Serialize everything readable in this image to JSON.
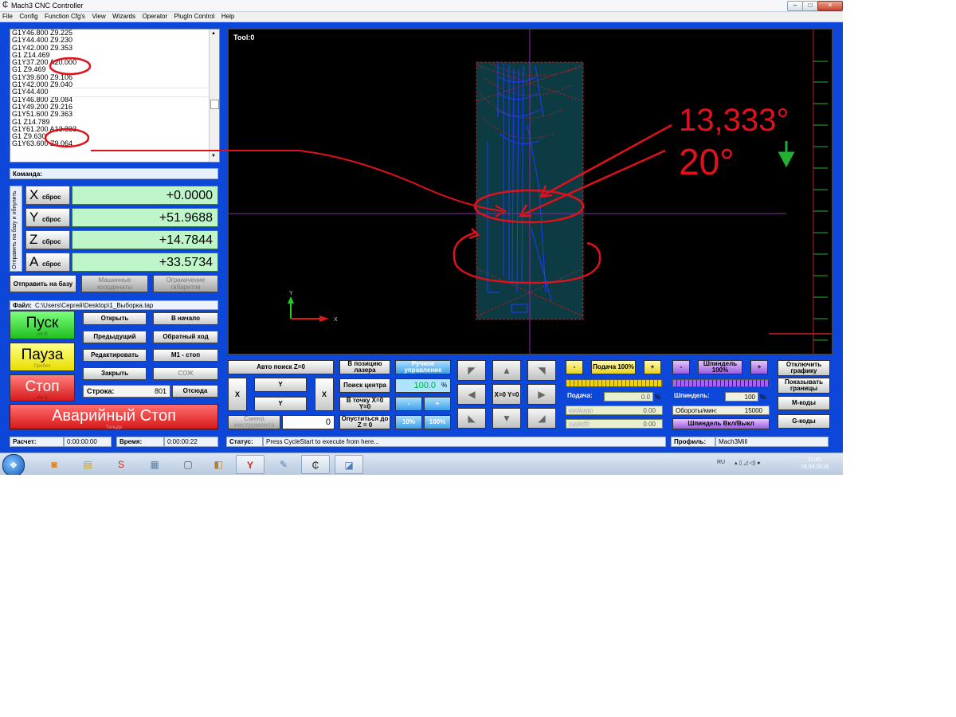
{
  "window": {
    "title": "Mach3 CNC Controller",
    "min": "–",
    "max": "□",
    "close": "✕"
  },
  "menu": [
    "File",
    "Config",
    "Function Cfg's",
    "View",
    "Wizards",
    "Operator",
    "PlugIn Control",
    "Help"
  ],
  "gcode_lines": [
    "G1Y46.800 Z9.225",
    "G1Y44.400 Z9.230",
    "G1Y42.000 Z9.353",
    "G1 Z14.469",
    "G1Y37.200 A20.000",
    "G1 Z9.469",
    "G1Y39.600 Z9.106",
    "G1Y42.000 Z9.040",
    "G1Y44.400",
    "G1Y46.800 Z9.084",
    "G1Y49.200 Z9.216",
    "G1Y51.600 Z9.363",
    "G1 Z14.789",
    "G1Y61.200 A13.333",
    "G1 Z9.630",
    "G1Y63.600 Z9.064"
  ],
  "command_label": "Команда:",
  "side_tab": "Отправить на базу и обнулить",
  "dro": [
    {
      "axis": "X",
      "label": "сброс",
      "value": "+0.0000"
    },
    {
      "axis": "Y",
      "label": "сброс",
      "value": "+51.9688"
    },
    {
      "axis": "Z",
      "label": "сброс",
      "value": "+14.7844"
    },
    {
      "axis": "A",
      "label": "сброс",
      "value": "+33.5734"
    }
  ],
  "btn_ref_home": "Отправить на базу",
  "btn_machine_coords": "Машинные координаты",
  "btn_soft_limits": "Ограничение габаритов",
  "file": {
    "label": "Файл:",
    "path": "C:\\Users\\Сергей\\Desktop\\1_Выборка.tap"
  },
  "cycle_start": {
    "label": "Пуск",
    "hotkey": "Alt-R"
  },
  "feed_hold": {
    "label": "Пауза",
    "hotkey": "Пробел"
  },
  "stop": {
    "label": "Стоп",
    "hotkey": "Alt-S"
  },
  "btn_open": "Открыть",
  "btn_rewind": "В начало",
  "btn_prev": "Предыдущий",
  "btn_reverse": "Обратный ход",
  "btn_edit": "Редактировать",
  "btn_m1": "M1 - стоп",
  "btn_close": "Закрыть",
  "btn_coolant": "СОЖ",
  "line": {
    "label": "Строка:",
    "value": "801",
    "run_from": "Отсюда"
  },
  "estop": {
    "label": "Аварийный Стоп",
    "hotkey": "Тильда"
  },
  "tool_label": "Tool:0",
  "annotations": {
    "angle1": "13,333°",
    "angle2": "20°"
  },
  "controls": {
    "auto_z": "Авто поиск Z=0",
    "laser_pos": "В позицию лазера",
    "manual": "Ручное управление",
    "center": "Поиск центра",
    "jog_pct": "100.0",
    "pct": "%",
    "goto_zero": "В точку X=0 Y=0",
    "lower_z": "Опуститься до Z = 0",
    "tool_change": "Смена инструмента",
    "tool_value": "0",
    "p10": "10%",
    "p100": "100%",
    "minus": "-",
    "plus": "+",
    "x": "X",
    "y": "Y",
    "xy0": "X=0 Y=0",
    "feed": "Подача 100%",
    "feed_label": "Подача:",
    "feed_val": "0.0",
    "mm_min": "мм/мин",
    "mm_min_val": "0.00",
    "mm_rev": "мм/об:",
    "mm_rev_val": "0.00",
    "spindle": "Шпиндель 100%",
    "spindle_label": "Шпиндель:",
    "spindle_val": "100",
    "rpm_label": "Обороты/мин:",
    "rpm_val": "15000",
    "spindle_toggle": "Шпиндель Вкл/Выкл",
    "disable_graphics": "Отключить графику",
    "show_bounds": "Показывать границы",
    "mcodes": "M-коды",
    "gcodes": "G-коды"
  },
  "status": {
    "calc_label": "Расчет:",
    "calc_val": "0:00:00:00",
    "time_label": "Время:",
    "time_val": "0:00:00:22",
    "status_label": "Статус:",
    "status_text": "Press CycleStart to execute from here...",
    "profile_label": "Профиль:",
    "profile_val": "Mach3Mill"
  },
  "tray": {
    "lang": "RU",
    "time": "21:45",
    "date": "16.04.2018"
  },
  "colors": {
    "accent": "#0d47d9",
    "dro_bg": "#bef5c9",
    "annotation": "#e0111b",
    "toolpath": "#1f3dff"
  }
}
